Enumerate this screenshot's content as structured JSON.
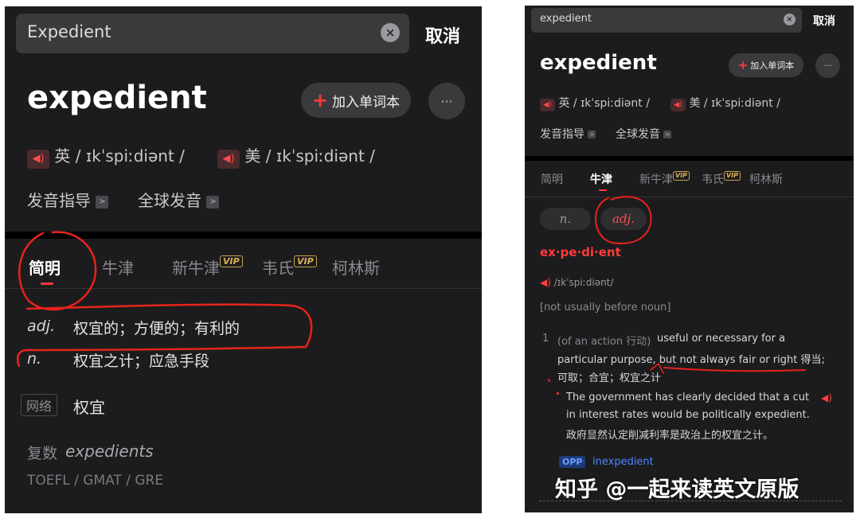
{
  "left": {
    "search": {
      "value": "Expedient",
      "clear_icon": "clear-icon",
      "cancel_label": "取消"
    },
    "headword": "expedient",
    "add_button_label": "加入单词本",
    "more_icon": "ellipsis-icon",
    "pron": {
      "uk_label": "英",
      "uk_ipa": "/ ɪkˈspiːdiənt /",
      "us_label": "美",
      "us_ipa": "/ ɪkˈspiːdiənt /",
      "guide": "发音指导",
      "global": "全球发音"
    },
    "tabs": [
      "简明",
      "牛津",
      "新牛津",
      "韦氏",
      "柯林斯"
    ],
    "vip_label": "VIP",
    "defs": [
      {
        "pos": "adj.",
        "text": "权宜的；方便的；有利的"
      },
      {
        "pos": "n.",
        "text": "权宜之计；应急手段"
      }
    ],
    "web": {
      "tag": "网络",
      "text": "权宜"
    },
    "plural": {
      "label": "复数",
      "word": "expedients"
    },
    "exams": "TOEFL / GMAT / GRE"
  },
  "right": {
    "search": {
      "value": "expedient",
      "clear_icon": "clear-icon",
      "cancel_label": "取消"
    },
    "headword": "expedient",
    "add_button_label": "加入单词本",
    "more_icon": "ellipsis-icon",
    "pron": {
      "uk_label": "英",
      "uk_ipa": "/ ɪkˈspiːdiənt /",
      "us_label": "美",
      "us_ipa": "/ ɪkˈspiːdiənt /",
      "guide": "发音指导",
      "global": "全球发音"
    },
    "tabs": [
      "简明",
      "牛津",
      "新牛津",
      "韦氏",
      "柯林斯"
    ],
    "vip_label": "VIP",
    "pos_chips": [
      "n.",
      "adj."
    ],
    "syllables": "ex·pe·di·ent",
    "ipa": "/ɪkˈspiːdiənt/",
    "grammar": "[not usually before noun]",
    "sense": {
      "num": "1",
      "label": "(of an action 行动)",
      "line1": "useful or necessary for a",
      "line2": "particular purpose, but not always fair or right 得当;",
      "line3": "可取；合宜；权宜之计"
    },
    "example": {
      "line1": "The government has clearly decided that a cut",
      "line2": "in interest rates would be politically expedient.",
      "zh": "政府显然认定削减利率是政治上的权宜之计。"
    },
    "opp": {
      "tag": "OPP",
      "word": "inexpedient"
    }
  },
  "watermark": "知乎 @一起来读英文原版",
  "colors": {
    "accent": "#ff3b3b",
    "background": "#1c1c1e",
    "vip": "#d9b25a",
    "link": "#4f86ff"
  }
}
